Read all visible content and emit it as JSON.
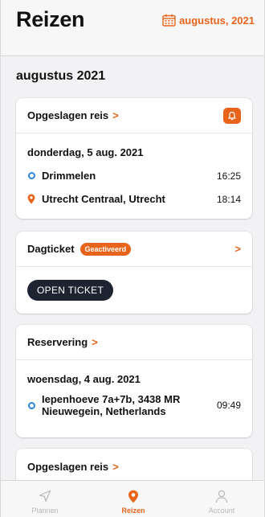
{
  "header": {
    "title": "Reizen",
    "month_label": "augustus, 2021"
  },
  "section_title": "augustus 2021",
  "cards": [
    {
      "title": "Opgeslagen reis",
      "chevron": ">",
      "date": "donderdag, 5 aug. 2021",
      "stops": [
        {
          "name": "Drimmelen",
          "time": "16:25"
        },
        {
          "name": "Utrecht Centraal, Utrecht",
          "time": "18:14"
        }
      ]
    },
    {
      "title": "Dagticket",
      "badge": "Geactiveerd",
      "chevron": ">",
      "button_label": "OPEN TICKET"
    },
    {
      "title": "Reservering",
      "chevron": ">",
      "date": "woensdag, 4 aug. 2021",
      "stops": [
        {
          "name_line1": "Iepenhoeve 7a+7b, 3438 MR",
          "name_line2": "Nieuwegein, Netherlands",
          "time": "09:49"
        }
      ]
    },
    {
      "title": "Opgeslagen reis",
      "chevron": ">"
    }
  ],
  "tabbar": [
    {
      "label": "Plannen",
      "icon": "navigation-arrow-icon"
    },
    {
      "label": "Reizen",
      "icon": "location-pin-icon"
    },
    {
      "label": "Account",
      "icon": "person-icon"
    }
  ],
  "colors": {
    "accent": "#e8641b",
    "origin_dot": "#2f86d9",
    "button_dark": "#1d2330"
  }
}
